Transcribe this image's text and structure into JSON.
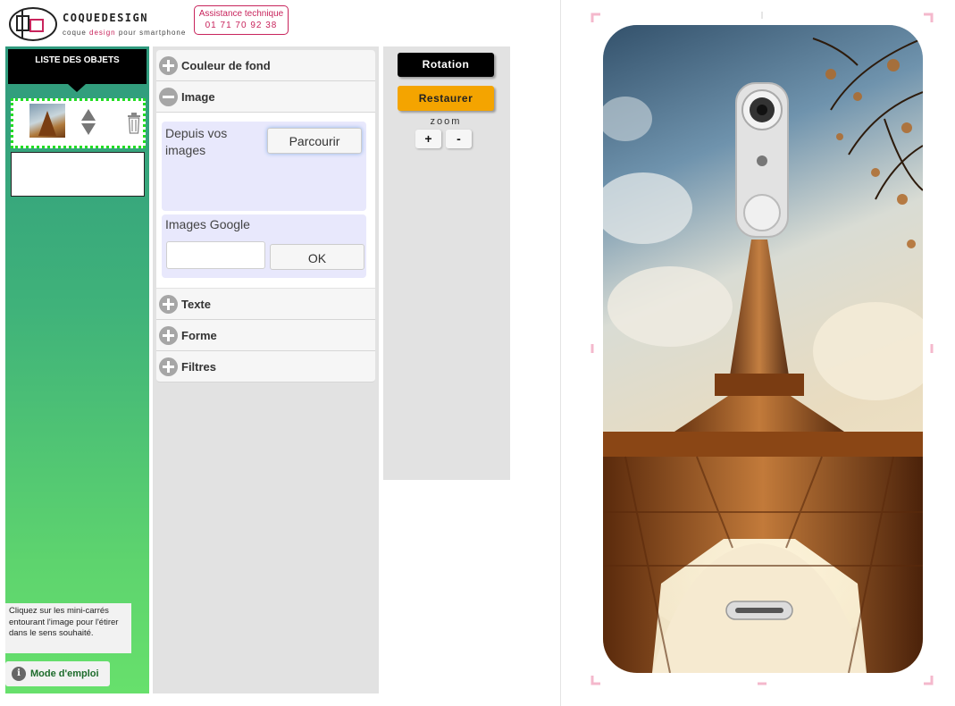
{
  "header": {
    "logo_name": "COQUEDESIGN",
    "logo_tag_a": "coque ",
    "logo_tag_b": "design",
    "logo_tag_c": " pour  smartphone",
    "support_title": "Assistance technique",
    "support_phone": "01 71 70 92 38"
  },
  "objects": {
    "title": "LISTE DES OBJETS",
    "hint": "Cliquez sur les mini-carrés entourant l'image pour l'étirer dans le sens souhaité.",
    "howto_label": "Mode d'emploi",
    "howto_icon": "info-icon"
  },
  "accordion": {
    "sections": [
      {
        "label": "Couleur de fond",
        "state": "collapsed"
      },
      {
        "label": "Image",
        "state": "expanded"
      },
      {
        "label": "Texte",
        "state": "collapsed"
      },
      {
        "label": "Forme",
        "state": "collapsed"
      },
      {
        "label": "Filtres",
        "state": "collapsed"
      }
    ],
    "image_panel": {
      "local_label": "Depuis vos images",
      "browse_label": "Parcourir",
      "google_label": "Images Google",
      "google_value": "",
      "ok_label": "OK"
    }
  },
  "controls": {
    "rotation_label": "Rotation",
    "restore_label": "Restaurer",
    "zoom_label": "zoom",
    "zoom_in_label": "+",
    "zoom_out_label": "-"
  },
  "colors": {
    "brand_pink": "#c8245c",
    "restore_orange": "#f4a400",
    "selection_green": "#22dd22",
    "panel_lavender": "#e8e8fc"
  }
}
